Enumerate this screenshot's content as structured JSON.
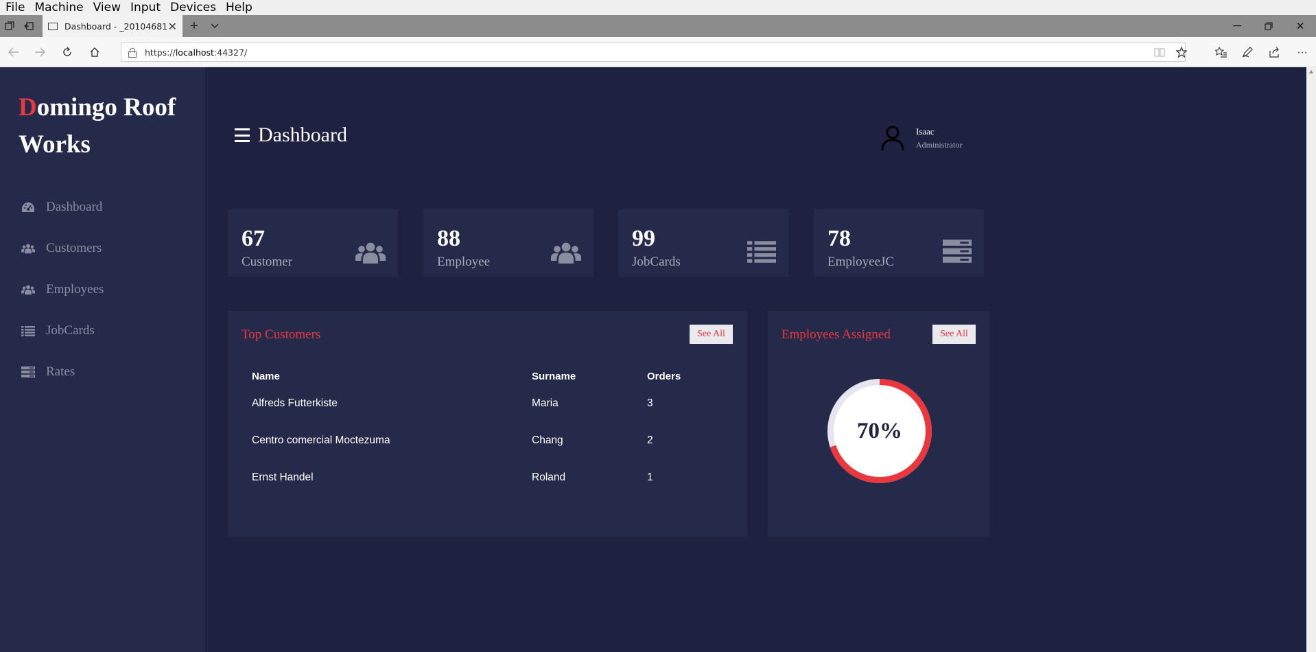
{
  "vm_menu": [
    "File",
    "Machine",
    "View",
    "Input",
    "Devices",
    "Help"
  ],
  "browser": {
    "tab_title": "Dashboard - _20104681",
    "url_scheme": "https://",
    "url_host": "localhost",
    "url_rest": ":44327/"
  },
  "app": {
    "brand_first": "D",
    "brand_rest": "omingo Roof Works",
    "page_title": "Dashboard",
    "user": {
      "name": "Isaac",
      "role": "Administrator"
    },
    "nav": [
      {
        "label": "Dashboard",
        "icon": "dashboard-icon"
      },
      {
        "label": "Customers",
        "icon": "users-icon"
      },
      {
        "label": "Employees",
        "icon": "users-icon"
      },
      {
        "label": "JobCards",
        "icon": "list-icon"
      },
      {
        "label": "Rates",
        "icon": "server-icon"
      }
    ],
    "cards": [
      {
        "value": "67",
        "label": "Customer",
        "icon": "users-icon"
      },
      {
        "value": "88",
        "label": "Employee",
        "icon": "users-icon"
      },
      {
        "value": "99",
        "label": "JobCards",
        "icon": "list-icon"
      },
      {
        "value": "78",
        "label": "EmployeeJC",
        "icon": "server-icon"
      }
    ],
    "top_customers": {
      "title": "Top Customers",
      "see_all": "See All",
      "columns": [
        "Name",
        "Surname",
        "Orders"
      ],
      "rows": [
        [
          "Alfreds Futterkiste",
          "Maria",
          "3"
        ],
        [
          "Centro comercial Moctezuma",
          "Chang",
          "2"
        ],
        [
          "Ernst Handel",
          "Roland",
          "1"
        ]
      ]
    },
    "employees_assigned": {
      "title": "Employees Assigned",
      "see_all": "See All",
      "percent_label": "70%",
      "fraction": 0.7
    },
    "colors": {
      "accent": "#e8383d",
      "bg": "#1e2140",
      "panel": "#262a4a",
      "muted": "#8a8ca0"
    }
  }
}
